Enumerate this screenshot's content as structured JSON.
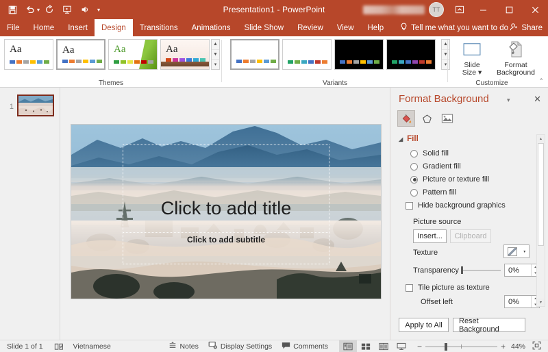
{
  "titlebar": {
    "document_title": "Presentation1  -  PowerPoint",
    "avatar_initials": "TT",
    "qat": [
      {
        "name": "save-button",
        "label": "Save"
      },
      {
        "name": "undo-button",
        "label": "Undo"
      },
      {
        "name": "redo-button",
        "label": "Redo"
      },
      {
        "name": "start-from-beginning-button",
        "label": "Start From Beginning"
      },
      {
        "name": "audio-button",
        "label": "Audio"
      },
      {
        "name": "customize-qat-button",
        "label": "Customize Quick Access Toolbar"
      }
    ],
    "ribbon_display_label": "Ribbon Display Options",
    "minimize_label": "–",
    "maximize_label": "☐",
    "close_label": "✕"
  },
  "tabs": [
    {
      "label": "File",
      "active": false
    },
    {
      "label": "Home",
      "active": false
    },
    {
      "label": "Insert",
      "active": false
    },
    {
      "label": "Design",
      "active": true
    },
    {
      "label": "Transitions",
      "active": false
    },
    {
      "label": "Animations",
      "active": false
    },
    {
      "label": "Slide Show",
      "active": false
    },
    {
      "label": "Review",
      "active": false
    },
    {
      "label": "View",
      "active": false
    },
    {
      "label": "Help",
      "active": false
    }
  ],
  "tellme": {
    "label": "Tell me what you want to do"
  },
  "share": {
    "label": "Share"
  },
  "ribbon": {
    "themes": {
      "group_label": "Themes",
      "items": [
        {
          "name": "theme-office",
          "aa": "Aa",
          "style": "plain",
          "selected": false,
          "swatches": [
            "#4472c4",
            "#ed7d31",
            "#a5a5a5",
            "#ffc000",
            "#5b9bd5",
            "#70ad47"
          ]
        },
        {
          "name": "theme-office-2",
          "aa": "Aa",
          "style": "plain",
          "selected": true,
          "swatches": [
            "#4472c4",
            "#ed7d31",
            "#a5a5a5",
            "#ffc000",
            "#5b9bd5",
            "#70ad47"
          ]
        },
        {
          "name": "theme-facet",
          "aa": "Aa",
          "style": "green",
          "selected": false,
          "swatches": [
            "#2f9e41",
            "#90c226",
            "#e7e647",
            "#e2720f",
            "#c00000",
            "#a5a5a5"
          ]
        },
        {
          "name": "theme-wood-type",
          "aa": "Aa",
          "style": "wood",
          "selected": false,
          "swatches": [
            "#d34817",
            "#cc3399",
            "#9b51e0",
            "#3a7ad9",
            "#2fa8d5",
            "#49c3b1"
          ]
        }
      ],
      "scroll": {
        "up": "▲",
        "down": "▼",
        "more": "▾"
      }
    },
    "variants": {
      "group_label": "Variants",
      "items": [
        {
          "name": "variant-1",
          "dark": false,
          "selected": true,
          "swatches": [
            "#4472c4",
            "#ed7d31",
            "#a5a5a5",
            "#ffc000",
            "#5b9bd5",
            "#70ad47"
          ]
        },
        {
          "name": "variant-2",
          "dark": false,
          "selected": false,
          "swatches": [
            "#21a366",
            "#70ad47",
            "#3aa8c1",
            "#4472c4",
            "#c0392b",
            "#ed7d31"
          ]
        },
        {
          "name": "variant-3",
          "dark": true,
          "selected": false,
          "swatches": [
            "#4472c4",
            "#ed7d31",
            "#a5a5a5",
            "#ffc000",
            "#5b9bd5",
            "#70ad47"
          ]
        },
        {
          "name": "variant-4",
          "dark": true,
          "selected": false,
          "swatches": [
            "#21a366",
            "#3aa8c1",
            "#4472c4",
            "#8e44ad",
            "#c0392b",
            "#ed7d31"
          ]
        }
      ],
      "scroll": {
        "up": "▲",
        "down": "▼",
        "more": "▾"
      }
    },
    "customize": {
      "group_label": "Customize",
      "slide_size_label": "Slide\nSize ▾",
      "slide_size_line1": "Slide",
      "slide_size_line2": "Size ▾",
      "format_background_line1": "Format",
      "format_background_line2": "Background",
      "collapse_label": "⌃"
    }
  },
  "slides_pane": {
    "items": [
      {
        "number": "1",
        "name": "slide-thumbnail-1",
        "selected": true
      }
    ]
  },
  "slide": {
    "title_placeholder": "Click to add title",
    "subtitle_placeholder": "Click to add subtitle"
  },
  "format_background": {
    "title": "Format Background",
    "caret": "▾",
    "close": "✕",
    "tabs": [
      {
        "name": "fill-tab",
        "icon": "paint-bucket-icon",
        "active": true
      },
      {
        "name": "effects-tab",
        "icon": "pentagon-icon",
        "active": false
      },
      {
        "name": "picture-tab",
        "icon": "picture-icon",
        "active": false
      }
    ],
    "fill_section_label": "Fill",
    "fill_options": [
      {
        "label": "Solid fill",
        "name": "solid-fill-radio",
        "selected": false
      },
      {
        "label": "Gradient fill",
        "name": "gradient-fill-radio",
        "selected": false
      },
      {
        "label": "Picture or texture fill",
        "name": "picture-or-texture-fill-radio",
        "selected": true
      },
      {
        "label": "Pattern fill",
        "name": "pattern-fill-radio",
        "selected": false
      }
    ],
    "hide_background_graphics": {
      "label": "Hide background graphics",
      "checked": false
    },
    "picture_source_label": "Picture source",
    "insert_button": "Insert...",
    "clipboard_button": "Clipboard",
    "texture_label": "Texture",
    "texture_caret": "▾",
    "transparency_label": "Transparency",
    "transparency_value": "0%",
    "tile_picture_label": "Tile picture as texture",
    "tile_picture_checked": false,
    "offset_left_label": "Offset left",
    "offset_left_value": "0%",
    "apply_to_all_button": "Apply to All",
    "reset_background_button": "Reset Background",
    "spin_up": "▴",
    "spin_down": "▾",
    "scroll_up": "▴",
    "scroll_down": "▾"
  },
  "status": {
    "slide_counter": "Slide 1 of 1",
    "spellcheck_icon_name": "spell-check-icon",
    "language": "Vietnamese",
    "notes_label": "Notes",
    "display_settings_label": "Display Settings",
    "comments_label": "Comments",
    "views": [
      {
        "name": "normal-view-button",
        "active": true
      },
      {
        "name": "slide-sorter-view-button",
        "active": false
      },
      {
        "name": "reading-view-button",
        "active": false
      },
      {
        "name": "slide-show-button",
        "active": false
      }
    ],
    "zoom_out": "−",
    "zoom_in": "+",
    "zoom_level": "44%",
    "fit_label": "Fit slide to current window"
  },
  "colors": {
    "brand": "#b7472a",
    "accent_text": "#b7472a",
    "chrome": "#f0f0f0"
  }
}
